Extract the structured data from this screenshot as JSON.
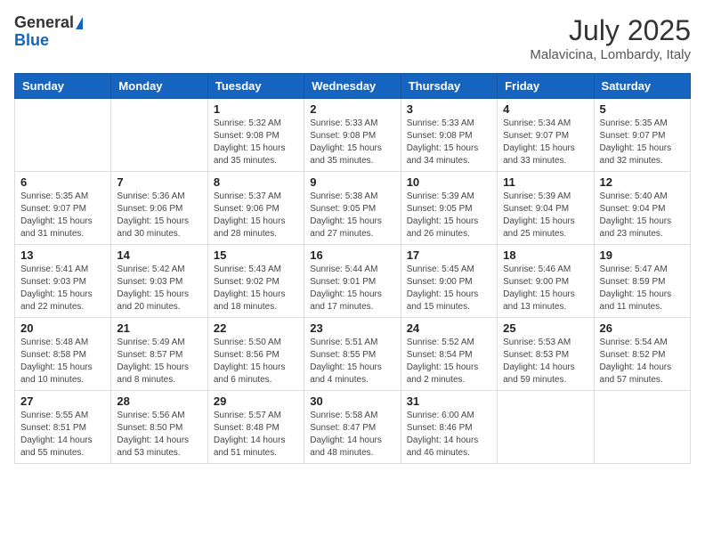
{
  "logo": {
    "general": "General",
    "blue": "Blue"
  },
  "title": {
    "month_year": "July 2025",
    "location": "Malavicina, Lombardy, Italy"
  },
  "headers": [
    "Sunday",
    "Monday",
    "Tuesday",
    "Wednesday",
    "Thursday",
    "Friday",
    "Saturday"
  ],
  "weeks": [
    [
      {
        "day": "",
        "info": ""
      },
      {
        "day": "",
        "info": ""
      },
      {
        "day": "1",
        "info": "Sunrise: 5:32 AM\nSunset: 9:08 PM\nDaylight: 15 hours and 35 minutes."
      },
      {
        "day": "2",
        "info": "Sunrise: 5:33 AM\nSunset: 9:08 PM\nDaylight: 15 hours and 35 minutes."
      },
      {
        "day": "3",
        "info": "Sunrise: 5:33 AM\nSunset: 9:08 PM\nDaylight: 15 hours and 34 minutes."
      },
      {
        "day": "4",
        "info": "Sunrise: 5:34 AM\nSunset: 9:07 PM\nDaylight: 15 hours and 33 minutes."
      },
      {
        "day": "5",
        "info": "Sunrise: 5:35 AM\nSunset: 9:07 PM\nDaylight: 15 hours and 32 minutes."
      }
    ],
    [
      {
        "day": "6",
        "info": "Sunrise: 5:35 AM\nSunset: 9:07 PM\nDaylight: 15 hours and 31 minutes."
      },
      {
        "day": "7",
        "info": "Sunrise: 5:36 AM\nSunset: 9:06 PM\nDaylight: 15 hours and 30 minutes."
      },
      {
        "day": "8",
        "info": "Sunrise: 5:37 AM\nSunset: 9:06 PM\nDaylight: 15 hours and 28 minutes."
      },
      {
        "day": "9",
        "info": "Sunrise: 5:38 AM\nSunset: 9:05 PM\nDaylight: 15 hours and 27 minutes."
      },
      {
        "day": "10",
        "info": "Sunrise: 5:39 AM\nSunset: 9:05 PM\nDaylight: 15 hours and 26 minutes."
      },
      {
        "day": "11",
        "info": "Sunrise: 5:39 AM\nSunset: 9:04 PM\nDaylight: 15 hours and 25 minutes."
      },
      {
        "day": "12",
        "info": "Sunrise: 5:40 AM\nSunset: 9:04 PM\nDaylight: 15 hours and 23 minutes."
      }
    ],
    [
      {
        "day": "13",
        "info": "Sunrise: 5:41 AM\nSunset: 9:03 PM\nDaylight: 15 hours and 22 minutes."
      },
      {
        "day": "14",
        "info": "Sunrise: 5:42 AM\nSunset: 9:03 PM\nDaylight: 15 hours and 20 minutes."
      },
      {
        "day": "15",
        "info": "Sunrise: 5:43 AM\nSunset: 9:02 PM\nDaylight: 15 hours and 18 minutes."
      },
      {
        "day": "16",
        "info": "Sunrise: 5:44 AM\nSunset: 9:01 PM\nDaylight: 15 hours and 17 minutes."
      },
      {
        "day": "17",
        "info": "Sunrise: 5:45 AM\nSunset: 9:00 PM\nDaylight: 15 hours and 15 minutes."
      },
      {
        "day": "18",
        "info": "Sunrise: 5:46 AM\nSunset: 9:00 PM\nDaylight: 15 hours and 13 minutes."
      },
      {
        "day": "19",
        "info": "Sunrise: 5:47 AM\nSunset: 8:59 PM\nDaylight: 15 hours and 11 minutes."
      }
    ],
    [
      {
        "day": "20",
        "info": "Sunrise: 5:48 AM\nSunset: 8:58 PM\nDaylight: 15 hours and 10 minutes."
      },
      {
        "day": "21",
        "info": "Sunrise: 5:49 AM\nSunset: 8:57 PM\nDaylight: 15 hours and 8 minutes."
      },
      {
        "day": "22",
        "info": "Sunrise: 5:50 AM\nSunset: 8:56 PM\nDaylight: 15 hours and 6 minutes."
      },
      {
        "day": "23",
        "info": "Sunrise: 5:51 AM\nSunset: 8:55 PM\nDaylight: 15 hours and 4 minutes."
      },
      {
        "day": "24",
        "info": "Sunrise: 5:52 AM\nSunset: 8:54 PM\nDaylight: 15 hours and 2 minutes."
      },
      {
        "day": "25",
        "info": "Sunrise: 5:53 AM\nSunset: 8:53 PM\nDaylight: 14 hours and 59 minutes."
      },
      {
        "day": "26",
        "info": "Sunrise: 5:54 AM\nSunset: 8:52 PM\nDaylight: 14 hours and 57 minutes."
      }
    ],
    [
      {
        "day": "27",
        "info": "Sunrise: 5:55 AM\nSunset: 8:51 PM\nDaylight: 14 hours and 55 minutes."
      },
      {
        "day": "28",
        "info": "Sunrise: 5:56 AM\nSunset: 8:50 PM\nDaylight: 14 hours and 53 minutes."
      },
      {
        "day": "29",
        "info": "Sunrise: 5:57 AM\nSunset: 8:48 PM\nDaylight: 14 hours and 51 minutes."
      },
      {
        "day": "30",
        "info": "Sunrise: 5:58 AM\nSunset: 8:47 PM\nDaylight: 14 hours and 48 minutes."
      },
      {
        "day": "31",
        "info": "Sunrise: 6:00 AM\nSunset: 8:46 PM\nDaylight: 14 hours and 46 minutes."
      },
      {
        "day": "",
        "info": ""
      },
      {
        "day": "",
        "info": ""
      }
    ]
  ]
}
